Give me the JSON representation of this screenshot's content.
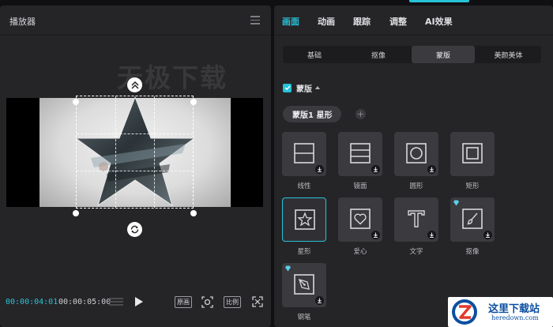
{
  "player": {
    "title": "播放器",
    "watermark": "无极下载",
    "time_current": "00:00:04:01",
    "time_total": "00:00:05:00",
    "btn_original": "原画",
    "btn_ratio": "比例"
  },
  "panel": {
    "tabs": [
      {
        "label": "画面",
        "active": true
      },
      {
        "label": "动画"
      },
      {
        "label": "跟踪"
      },
      {
        "label": "调整"
      },
      {
        "label": "AI效果"
      }
    ],
    "subtabs": [
      {
        "label": "基础"
      },
      {
        "label": "抠像"
      },
      {
        "label": "蒙版",
        "active": true
      },
      {
        "label": "美颜美体"
      }
    ],
    "mask_section_title": "蒙版",
    "mask_chip": "蒙版1 星形",
    "add_symbol": "+",
    "masks": [
      {
        "label": "线性",
        "icon": "linear-mask-icon"
      },
      {
        "label": "镜面",
        "icon": "mirror-mask-icon"
      },
      {
        "label": "圆形",
        "icon": "circle-mask-icon"
      },
      {
        "label": "矩形",
        "icon": "rectangle-mask-icon"
      },
      {
        "label": "星形",
        "icon": "star-mask-icon",
        "selected": true
      },
      {
        "label": "爱心",
        "icon": "heart-mask-icon"
      },
      {
        "label": "文字",
        "icon": "text-mask-icon"
      },
      {
        "label": "抠像",
        "icon": "brush-mask-icon",
        "premium": true
      },
      {
        "label": "钢笔",
        "icon": "pen-mask-icon",
        "premium": true
      }
    ]
  },
  "site_logo": {
    "cn": "这里下载站",
    "en": "heredown.com"
  },
  "colors": {
    "accent": "#27c2d8",
    "panel_bg": "#252528",
    "tile_bg": "#3a3a3f"
  }
}
